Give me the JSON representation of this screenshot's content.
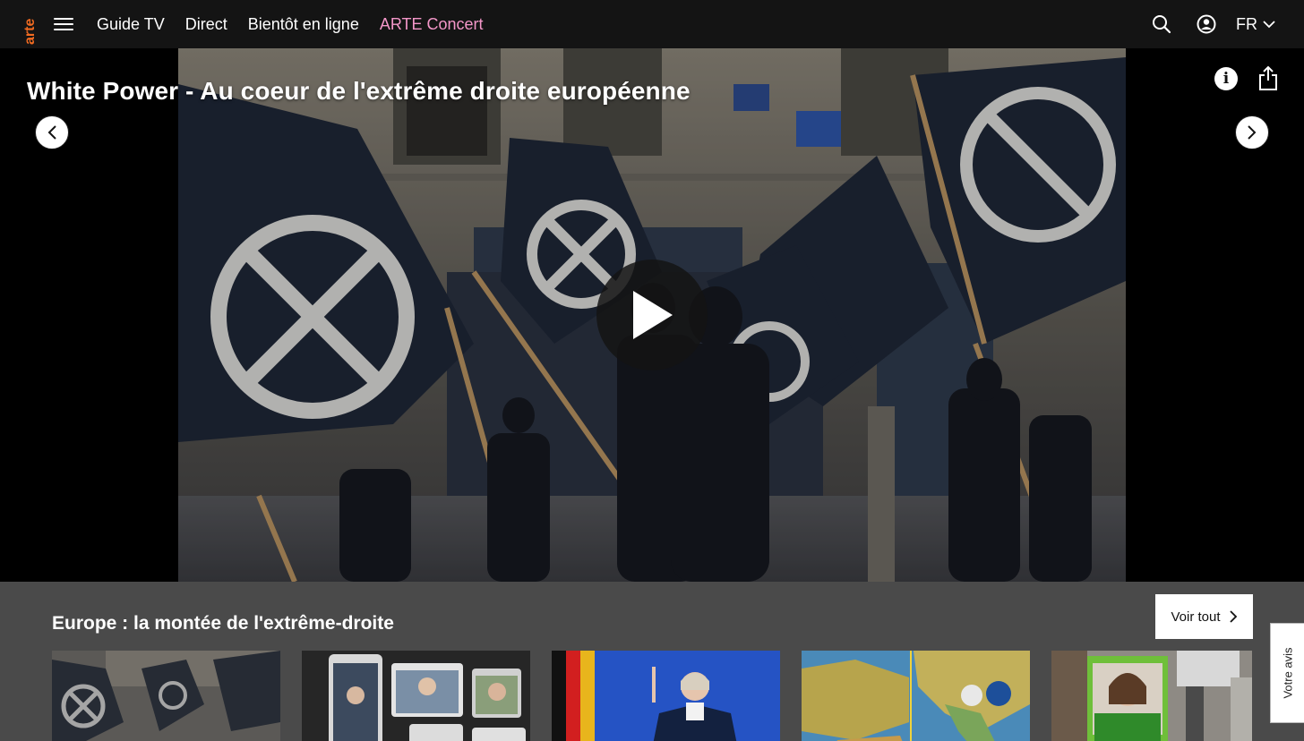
{
  "nav": {
    "logo": "arte",
    "menu_icon": "menu-icon",
    "links": [
      "Guide TV",
      "Direct",
      "Bientôt en ligne",
      "ARTE Concert"
    ],
    "concert_color": "#f497c9",
    "language": "FR"
  },
  "hero": {
    "title": "White Power - Au coeur de l'extrême droite européenne",
    "icons": [
      "info-icon",
      "share-icon",
      "play-icon"
    ]
  },
  "row": {
    "title": "Europe : la montée de l'extrême-droite",
    "voir_tout": "Voir tout",
    "thumbnails": [
      {
        "id": 1,
        "scene": "flags"
      },
      {
        "id": 2,
        "scene": "video-call"
      },
      {
        "id": 3,
        "scene": "speaker"
      },
      {
        "id": 4,
        "scene": "map"
      },
      {
        "id": 5,
        "scene": "poster"
      }
    ]
  },
  "feedback": {
    "label": "Votre avis"
  },
  "colors": {
    "nav_bg": "#141414",
    "row_bg": "#4a4a4a",
    "logo": "#f26b21",
    "accent": "#f497c9"
  }
}
